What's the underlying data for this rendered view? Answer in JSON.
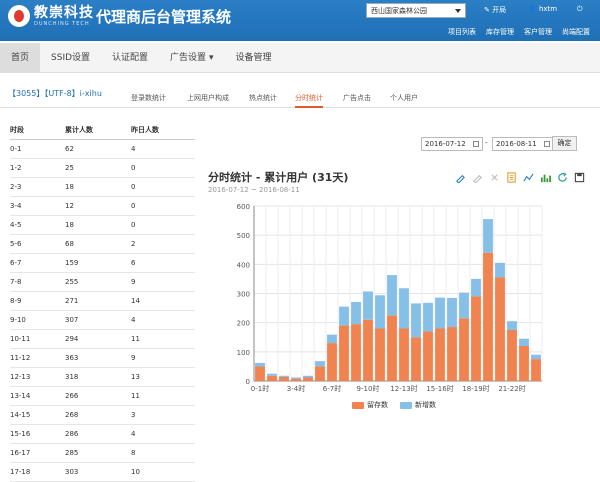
{
  "header": {
    "logo_cn": "教崇科技",
    "logo_en": "DUNCHING TECH",
    "system_title": "代理商后台管理系统",
    "site_select": "西山国家森林公园",
    "link_open": "开局",
    "user": "hxtm",
    "menu": [
      "项目列表",
      "库存管理",
      "客户管理",
      "尚端配置"
    ]
  },
  "nav": {
    "items": [
      "首页",
      "SSID设置",
      "认证配置",
      "广告设置",
      "设备管理"
    ]
  },
  "subnav": {
    "id_label": "【3055】【UTF-8】i-xihu",
    "tabs": [
      "登录数统计",
      "上网用户构成",
      "热点统计",
      "分时统计",
      "广告点击",
      "个人用户"
    ]
  },
  "table": {
    "headers": [
      "时段",
      "累计人数",
      "昨日人数"
    ],
    "rows": [
      [
        "0-1",
        "62",
        "4"
      ],
      [
        "1-2",
        "25",
        "0"
      ],
      [
        "2-3",
        "18",
        "0"
      ],
      [
        "3-4",
        "12",
        "0"
      ],
      [
        "4-5",
        "18",
        "0"
      ],
      [
        "5-6",
        "68",
        "2"
      ],
      [
        "6-7",
        "159",
        "6"
      ],
      [
        "7-8",
        "255",
        "9"
      ],
      [
        "8-9",
        "271",
        "14"
      ],
      [
        "9-10",
        "307",
        "4"
      ],
      [
        "10-11",
        "294",
        "11"
      ],
      [
        "11-12",
        "363",
        "9"
      ],
      [
        "12-13",
        "318",
        "13"
      ],
      [
        "13-14",
        "266",
        "11"
      ],
      [
        "14-15",
        "268",
        "3"
      ],
      [
        "15-16",
        "286",
        "4"
      ],
      [
        "16-17",
        "285",
        "8"
      ],
      [
        "17-18",
        "303",
        "10"
      ]
    ]
  },
  "dates": {
    "start": "2016-07-12",
    "sep": "-",
    "end": "2016-08-11",
    "confirm": "确定"
  },
  "chart_title": "分时统计 - 累计用户 (31天)",
  "chart_subtitle": "2016-07-12 ~ 2016-08-11",
  "chart_data": {
    "type": "bar",
    "stacked": true,
    "categories": [
      "0-1时",
      "1-2时",
      "2-3时",
      "3-4时",
      "4-5时",
      "5-6时",
      "6-7时",
      "7-8时",
      "8-9时",
      "9-10时",
      "10-11时",
      "11-12时",
      "12-13时",
      "13-14时",
      "14-15时",
      "15-16时",
      "16-17时",
      "17-18时",
      "18-19时",
      "19-20时",
      "20-21时",
      "21-22时",
      "22-23时",
      "23-24时"
    ],
    "x_tick_labels": [
      "0-1时",
      "3-4时",
      "6-7时",
      "9-10时",
      "12-13时",
      "15-16时",
      "18-19时",
      "21-22时"
    ],
    "series": [
      {
        "name": "留存数",
        "color": "#f0834f",
        "values": [
          50,
          18,
          14,
          8,
          12,
          50,
          130,
          190,
          195,
          210,
          180,
          225,
          180,
          150,
          170,
          180,
          185,
          215,
          290,
          440,
          355,
          175,
          120,
          75
        ]
      },
      {
        "name": "新增数",
        "color": "#86bfe8",
        "values": [
          12,
          7,
          4,
          4,
          6,
          18,
          29,
          65,
          76,
          97,
          114,
          138,
          138,
          116,
          98,
          106,
          100,
          88,
          60,
          115,
          50,
          30,
          25,
          15
        ]
      }
    ],
    "ylim": [
      0,
      600
    ],
    "yticks": [
      0,
      100,
      200,
      300,
      400,
      500,
      600
    ],
    "grid": true,
    "legend": "bottom"
  }
}
